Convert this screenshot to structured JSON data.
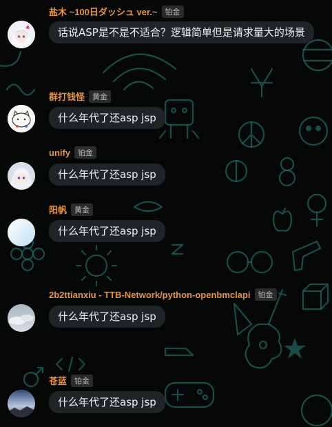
{
  "messages": [
    {
      "author": "盐木 ~100日ダッシュ ver.~",
      "badge": "铂金",
      "text": "话说ASP是不是不适合？逻辑简单但是请求量大的场景",
      "avatar": "anime-girl-white-hair-avatar"
    },
    {
      "author": "群打钱怪",
      "badge": "黄金",
      "text": "什么年代了还asp jsp",
      "avatar": "cartoon-cat-sketch-avatar"
    },
    {
      "author": "unify",
      "badge": "铂金",
      "text": "什么年代了还asp jsp",
      "avatar": "anime-girl-silver-hair-avatar"
    },
    {
      "author": "阳帆",
      "badge": "黄金",
      "text": "什么年代了还asp jsp",
      "avatar": "light-blue-sky-avatar"
    },
    {
      "author": "2b2ttianxiu - TTB-Network/python-openbmclapi",
      "badge": "铂金",
      "text": "什么年代了还asp jsp",
      "avatar": "cloudy-sky-avatar"
    },
    {
      "author": "苍蓝",
      "badge": "铂金",
      "text": "什么年代了还asp jsp",
      "avatar": "dusk-landscape-avatar"
    }
  ],
  "colors": {
    "background": "#050807",
    "wallpaper_pattern": "#1d6e66",
    "author_name": "#e8943c",
    "badge_bg": "#2a2c2c",
    "bubble_bg": "#1f2426",
    "bubble_text": "#f2f2f2"
  }
}
